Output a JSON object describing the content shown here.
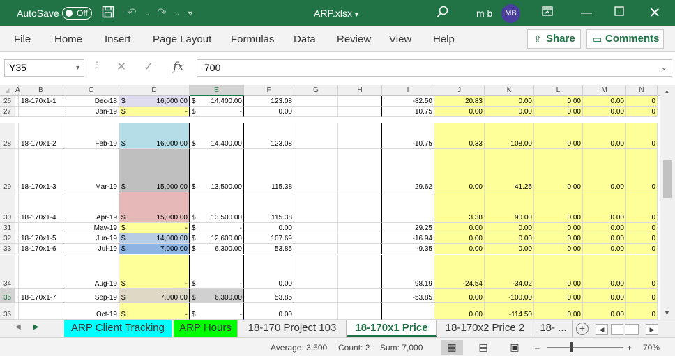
{
  "titlebar": {
    "autosave_label": "AutoSave",
    "autosave_state": "Off",
    "filename": "ARP.xlsx",
    "user_name": "m b",
    "user_initials": "MB"
  },
  "menu": [
    "File",
    "Home",
    "Insert",
    "Page Layout",
    "Formulas",
    "Data",
    "Review",
    "View",
    "Help"
  ],
  "share_label": "Share",
  "comments_label": "Comments",
  "formula_bar": {
    "name_box": "Y35",
    "fx_symbol": "fx",
    "value": "700"
  },
  "columns": [
    "A",
    "B",
    "C",
    "D",
    "E",
    "F",
    "G",
    "H",
    "I",
    "J",
    "K",
    "L",
    "M",
    "N"
  ],
  "rows": [
    {
      "num": "26",
      "B": "18-170x1-1",
      "C": "Dec-18",
      "D_sym": "$",
      "D": "16,000.00",
      "E_sym": "$",
      "E": "14,400.00",
      "F": "123.08",
      "I": "-82.50",
      "J": "20.83",
      "K": "0.00",
      "L": "0.00",
      "M": "0.00"
    },
    {
      "num": "27",
      "B": "",
      "C": "Jan-19",
      "D_sym": "$",
      "D": "-",
      "E_sym": "$",
      "E": "-",
      "F": "0.00",
      "I": "10.75",
      "J": "0.00",
      "K": "0.00",
      "L": "0.00",
      "M": "0.00"
    },
    {
      "num": "28",
      "B": "18-170x1-2",
      "C": "Feb-19",
      "D_sym": "$",
      "D": "16,000.00",
      "E_sym": "$",
      "E": "14,400.00",
      "F": "123.08",
      "I": "-10.75",
      "J": "0.33",
      "K": "108.00",
      "L": "0.00",
      "M": "0.00"
    },
    {
      "num": "29",
      "B": "18-170x1-3",
      "C": "Mar-19",
      "D_sym": "$",
      "D": "15,000.00",
      "E_sym": "$",
      "E": "13,500.00",
      "F": "115.38",
      "I": "29.62",
      "J": "0.00",
      "K": "41.25",
      "L": "0.00",
      "M": "0.00"
    },
    {
      "num": "30",
      "B": "18-170x1-4",
      "C": "Apr-19",
      "D_sym": "$",
      "D": "15,000.00",
      "E_sym": "$",
      "E": "13,500.00",
      "F": "115.38",
      "I": "",
      "J": "3.38",
      "K": "90.00",
      "L": "0.00",
      "M": "0.00"
    },
    {
      "num": "31",
      "B": "",
      "C": "May-19",
      "D_sym": "$",
      "D": "-",
      "E_sym": "$",
      "E": "-",
      "F": "0.00",
      "I": "29.25",
      "J": "0.00",
      "K": "0.00",
      "L": "0.00",
      "M": "0.00"
    },
    {
      "num": "32",
      "B": "18-170x1-5",
      "C": "Jun-19",
      "D_sym": "$",
      "D": "14,000.00",
      "E_sym": "$",
      "E": "12,600.00",
      "F": "107.69",
      "I": "-16.94",
      "J": "0.00",
      "K": "0.00",
      "L": "0.00",
      "M": "0.00"
    },
    {
      "num": "33",
      "B": "18-170x1-6",
      "C": "Jul-19",
      "D_sym": "$",
      "D": "7,000.00",
      "E_sym": "$",
      "E": "6,300.00",
      "F": "53.85",
      "I": "-9.35",
      "J": "0.00",
      "K": "0.00",
      "L": "0.00",
      "M": "0.00"
    },
    {
      "num": "34",
      "B": "",
      "C": "Aug-19",
      "D_sym": "$",
      "D": "-",
      "E_sym": "$",
      "E": "-",
      "F": "0.00",
      "I": "98.19",
      "J": "-24.54",
      "K": "-34.02",
      "L": "0.00",
      "M": "0.00"
    },
    {
      "num": "35",
      "B": "18-170x1-7",
      "C": "Sep-19",
      "D_sym": "$",
      "D": "7,000.00",
      "E_sym": "$",
      "E": "6,300.00",
      "F": "53.85",
      "I": "-53.85",
      "J": "0.00",
      "K": "-100.00",
      "L": "0.00",
      "M": "0.00"
    },
    {
      "num": "36",
      "B": "",
      "C": "Oct-19",
      "D_sym": "$",
      "D": "-",
      "E_sym": "$",
      "E": "-",
      "F": "0.00",
      "I": "",
      "J": "0.00",
      "K": "-114.50",
      "L": "0.00",
      "M": "0.00"
    }
  ],
  "d_fills": [
    "#e0dcef",
    "#ffff99",
    "#b4dde7",
    "#bfbfbf",
    "#e6b8b8",
    "#ffff99",
    "#b8cce4",
    "#8eb4e3",
    "#ffff99",
    "#ddd9c4",
    "#ffff99"
  ],
  "n_partial": "0",
  "sheet_tabs": [
    {
      "label": "ARP Client Tracking",
      "bg": "#00ffff"
    },
    {
      "label": "ARP Hours",
      "bg": "#00ff00"
    },
    {
      "label": "18-170 Project 103",
      "bg": ""
    },
    {
      "label": "18-170x1 Price",
      "bg": ""
    },
    {
      "label": "18-170x2 Price 2",
      "bg": ""
    },
    {
      "label": "18- ...",
      "bg": ""
    }
  ],
  "status": {
    "average": "Average: 3,500",
    "count": "Count: 2",
    "sum": "Sum: 7,000",
    "zoom": "70%"
  },
  "colors": {
    "accent": "#217346",
    "yellow_fill": "#ffff99",
    "selected_e": "#d0d0d0"
  }
}
